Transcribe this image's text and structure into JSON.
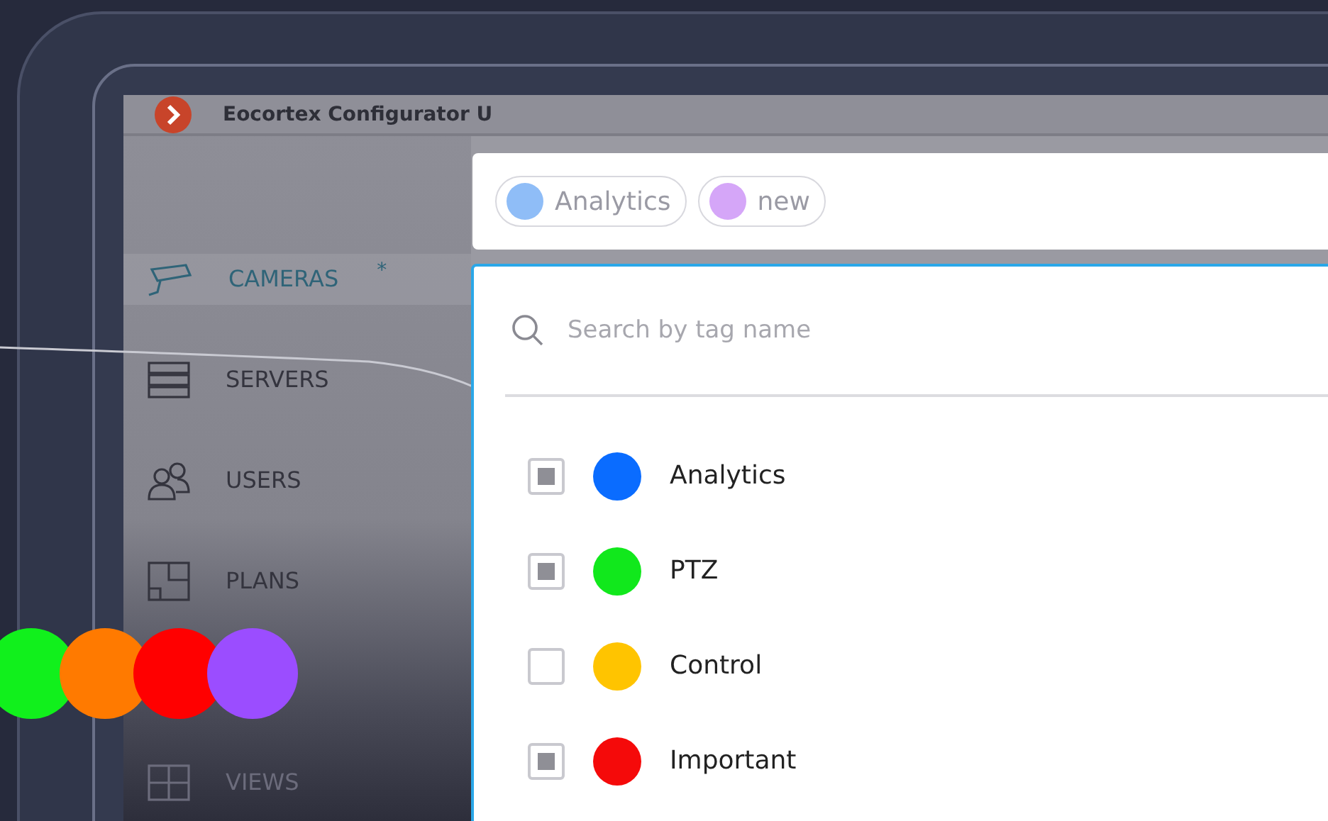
{
  "window": {
    "title": "Eocortex Configurator U"
  },
  "sidebar": {
    "items": [
      {
        "label": "CAMERAS",
        "badge": "*",
        "selected": true,
        "kind": "camera"
      },
      {
        "label": "SERVERS",
        "selected": false,
        "kind": "server"
      },
      {
        "label": "USERS",
        "selected": false,
        "kind": "users"
      },
      {
        "label": "PLANS",
        "selected": false,
        "kind": "plan"
      },
      {
        "label": "VIEWS",
        "selected": false,
        "kind": "view"
      }
    ]
  },
  "selected_tags": [
    {
      "label": "Analytics",
      "color": "#8fbdf7"
    },
    {
      "label": "new",
      "color": "#d5a6f8"
    }
  ],
  "tag_dropdown": {
    "search": {
      "placeholder": "Search by tag name"
    },
    "items": [
      {
        "label": "Analytics",
        "checked": true,
        "color": "#0a6cff"
      },
      {
        "label": "PTZ",
        "checked": true,
        "color": "#11e81c"
      },
      {
        "label": "Control",
        "checked": false,
        "color": "#ffc400"
      },
      {
        "label": "Important",
        "checked": true,
        "color": "#f50a0a"
      }
    ]
  },
  "color_dots": [
    {
      "color": "#11f01c"
    },
    {
      "color": "#ff7a00"
    },
    {
      "color": "#ff0000"
    },
    {
      "color": "#9b4dff"
    }
  ]
}
